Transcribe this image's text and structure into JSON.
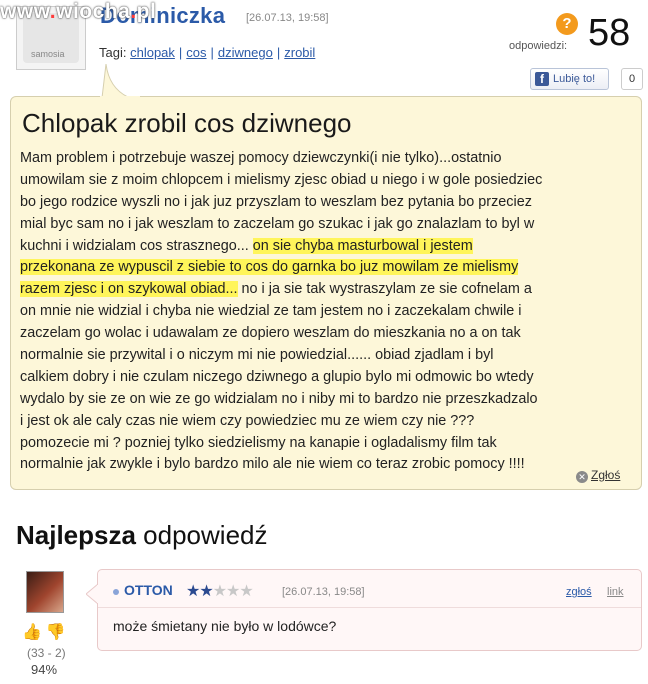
{
  "header": {
    "watermark": "www.wiocha.pl",
    "avatar_text": "samosia",
    "username": "Dominiczka",
    "date": "[26.07.13, 19:58]",
    "tags_label": "Tagi:",
    "tags": [
      "chlopak",
      "cos",
      "dziwnego",
      "zrobil"
    ],
    "responses_label": "odpowiedzi:",
    "responses_count": "58",
    "like_label": "Lubię to!",
    "like_count": "0"
  },
  "question": {
    "title": "Chlopak zrobil cos dziwnego",
    "lines": [
      {
        "pre": "Mam problem i potrzebuje waszej pomocy dziewczynki(i nie tylko)...ostatnio",
        "hl": "",
        "post": ""
      },
      {
        "pre": "umowilam sie z moim chlopcem i mielismy zjesc obiad u niego i w gole posiedziec",
        "hl": "",
        "post": ""
      },
      {
        "pre": "bo jego rodzice wyszli no i jak juz przyszlam to weszlam bez pytania bo przeciez",
        "hl": "",
        "post": ""
      },
      {
        "pre": "mial byc sam no i jak weszlam to zaczelam go szukac i jak go znalazlam to byl w",
        "hl": "",
        "post": ""
      },
      {
        "pre": "kuchni i widzialam cos strasznego... ",
        "hl": "on sie chyba masturbowal i jestem",
        "post": ""
      },
      {
        "pre": "",
        "hl": "przekonana ze wypuscil z siebie to cos do garnka bo juz mowilam ze mielismy",
        "post": ""
      },
      {
        "pre": "",
        "hl": "razem zjesc i on szykowal obiad...",
        "post": " no i ja sie tak wystraszylam ze sie cofnelam a"
      },
      {
        "pre": "on mnie nie widzial i chyba nie wiedzial ze tam jestem no i zaczekalam chwile i",
        "hl": "",
        "post": ""
      },
      {
        "pre": "zaczelam go wolac i udawalam ze dopiero weszlam do mieszkania no a on tak",
        "hl": "",
        "post": ""
      },
      {
        "pre": "normalnie sie przywital i o niczym mi nie powiedzial...... obiad zjadlam i byl",
        "hl": "",
        "post": ""
      },
      {
        "pre": "calkiem dobry i nie czulam niczego dziwnego a glupio bylo mi odmowic bo wtedy",
        "hl": "",
        "post": ""
      },
      {
        "pre": "wydalo by sie ze on wie ze go widzialam no i niby mi to bardzo nie przeszkadzalo",
        "hl": "",
        "post": ""
      },
      {
        "pre": "i jest ok ale caly czas nie wiem czy powiedziec mu ze wiem czy nie ???",
        "hl": "",
        "post": ""
      },
      {
        "pre": "pomozecie mi ? pozniej tylko siedzielismy na kanapie i ogladalismy film tak",
        "hl": "",
        "post": ""
      },
      {
        "pre": "normalnie jak zwykle i bylo bardzo milo ale nie wiem co teraz zrobic pomocy !!!!",
        "hl": "",
        "post": ""
      }
    ],
    "report_label": "Zgłoś"
  },
  "best_answer": {
    "heading_bold": "Najlepsza",
    "heading_rest": " odpowiedź",
    "author": "OTTON",
    "rating_stars": 2,
    "rating_max": 5,
    "date": "[26.07.13, 19:58]",
    "report_label": "zgłoś",
    "link_label": "link",
    "text": "może śmietany nie było w lodówce?",
    "votes": "(33 - 2)",
    "percent": "94%"
  },
  "colors": {
    "link": "#2b5aa8",
    "highlight": "#fff55a",
    "question_bg": "#fdf7d9",
    "answer_bg": "#fff7f7"
  }
}
